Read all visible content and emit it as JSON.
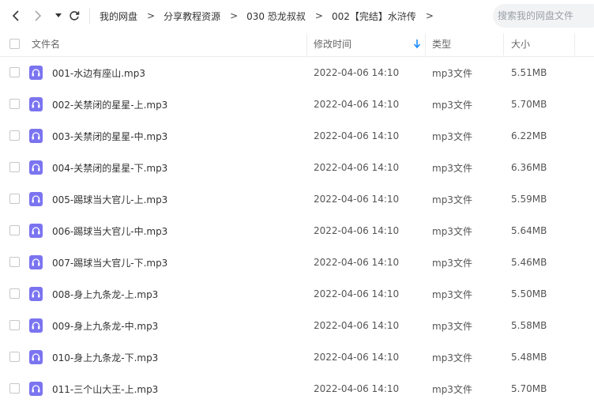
{
  "breadcrumb": [
    {
      "label": "我的网盘"
    },
    {
      "label": "分享教程资源"
    },
    {
      "label": "030 恐龙叔叔"
    },
    {
      "label": "002【完结】水浒传"
    }
  ],
  "search": {
    "placeholder": "搜索我的网盘文件"
  },
  "columns": {
    "name": "文件名",
    "modified": "修改时间",
    "type": "类型",
    "size": "大小"
  },
  "sort": {
    "column": "modified",
    "direction": "descending",
    "icon": "arrow-down-icon"
  },
  "accent_color": "#1a8cff",
  "file_icon_color": "#7b74f0",
  "files": [
    {
      "name": "001-水边有座山.mp3",
      "modified": "2022-04-06 14:10",
      "type": "mp3文件",
      "size": "5.51MB"
    },
    {
      "name": "002-关禁闭的星星-上.mp3",
      "modified": "2022-04-06 14:10",
      "type": "mp3文件",
      "size": "5.70MB"
    },
    {
      "name": "003-关禁闭的星星-中.mp3",
      "modified": "2022-04-06 14:10",
      "type": "mp3文件",
      "size": "6.22MB"
    },
    {
      "name": "004-关禁闭的星星-下.mp3",
      "modified": "2022-04-06 14:10",
      "type": "mp3文件",
      "size": "6.36MB"
    },
    {
      "name": "005-踢球当大官儿-上.mp3",
      "modified": "2022-04-06 14:10",
      "type": "mp3文件",
      "size": "5.59MB"
    },
    {
      "name": "006-踢球当大官儿-中.mp3",
      "modified": "2022-04-06 14:10",
      "type": "mp3文件",
      "size": "5.64MB"
    },
    {
      "name": "007-踢球当大官儿-下.mp3",
      "modified": "2022-04-06 14:10",
      "type": "mp3文件",
      "size": "5.46MB"
    },
    {
      "name": "008-身上九条龙-上.mp3",
      "modified": "2022-04-06 14:10",
      "type": "mp3文件",
      "size": "5.50MB"
    },
    {
      "name": "009-身上九条龙-中.mp3",
      "modified": "2022-04-06 14:10",
      "type": "mp3文件",
      "size": "5.58MB"
    },
    {
      "name": "010-身上九条龙-下.mp3",
      "modified": "2022-04-06 14:10",
      "type": "mp3文件",
      "size": "5.48MB"
    },
    {
      "name": "011-三个山大王-上.mp3",
      "modified": "2022-04-06 14:10",
      "type": "mp3文件",
      "size": "5.70MB"
    }
  ]
}
